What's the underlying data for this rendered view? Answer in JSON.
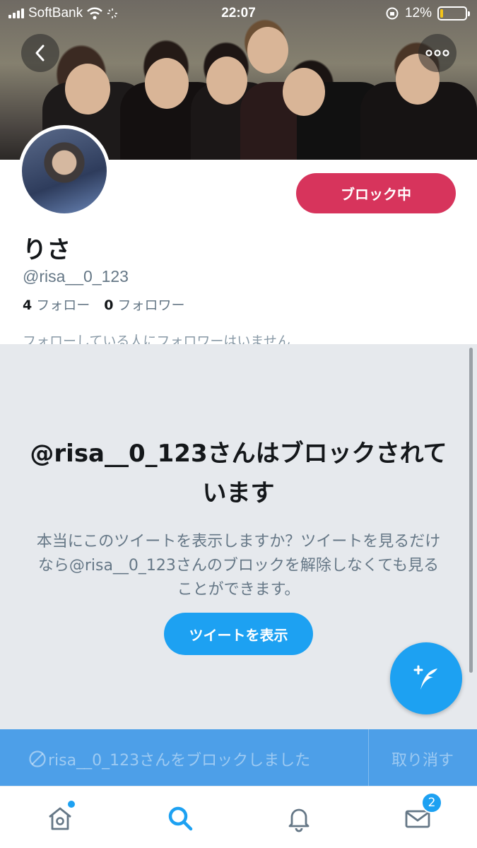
{
  "status_bar": {
    "carrier": "SoftBank",
    "time": "22:07",
    "battery_percent": "12%",
    "battery_level": 0.12
  },
  "header": {
    "back_icon": "chevron-left-icon",
    "more_icon": "ellipsis-icon"
  },
  "profile": {
    "block_button_label": "ブロック中",
    "display_name": "りさ",
    "handle": "@risa__0_123",
    "following_count": "4",
    "following_label": "フォロー",
    "followers_count": "0",
    "followers_label": "フォロワー",
    "followed_by_note": "フォローしている人にフォロワーはいません"
  },
  "blocked_panel": {
    "title": "@risa__0_123さんはブロックされています",
    "description": "本当にこのツイートを表示しますか？ツイートを見るだけなら@risa__0_123さんのブロックを解除しなくても見ることができます。",
    "show_tweets_label": "ツイートを表示"
  },
  "toast": {
    "message": "risa__0_123さんをブロックしました",
    "undo_label": "取り消す"
  },
  "tab_bar": {
    "messages_badge": "2"
  },
  "colors": {
    "accent": "#1da1f2",
    "block_red": "#d7345c",
    "panel_bg": "#e6e9ed",
    "toast_bg": "#4d9fe8"
  }
}
